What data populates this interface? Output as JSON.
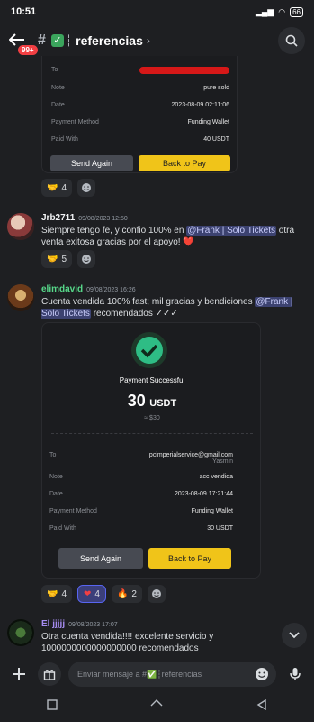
{
  "status_bar": {
    "time": "10:51",
    "battery": "66"
  },
  "header": {
    "unread_badge": "99+",
    "channel_title": "referencias"
  },
  "receipt1": {
    "rows": [
      {
        "key": "To",
        "value": ""
      },
      {
        "key": "Note",
        "value": "pure sold"
      },
      {
        "key": "Date",
        "value": "2023-08-09 02:11:06"
      },
      {
        "key": "Payment Method",
        "value": "Funding Wallet"
      },
      {
        "key": "Paid With",
        "value": "40 USDT"
      }
    ],
    "send_again": "Send Again",
    "back_to_pay": "Back to Pay"
  },
  "reactions1": [
    {
      "emoji": "handshake",
      "count": "4"
    }
  ],
  "msg1": {
    "author": "Jrb2711",
    "timestamp": "09/08/2023 12:50",
    "text_before": "Siempre tengo fe, y confio 100% en ",
    "mention": "@Frank | Solo Tickets",
    "text_after": " otra venta exitosa gracias por el apoyo! ❤️"
  },
  "reactions2": [
    {
      "emoji": "handshake",
      "count": "5"
    }
  ],
  "msg2": {
    "author": "elimdavid",
    "timestamp": "09/08/2023 16:26",
    "text_before": "Cuenta vendida 100% fast; mil gracias y bendiciones ",
    "mention": "@Frank | Solo Tickets",
    "text_after": " recomendados ✓✓✓"
  },
  "receipt2": {
    "status": "Payment Successful",
    "amount": "30",
    "currency": "USDT",
    "usd": "≈ $30",
    "rows": [
      {
        "key": "To",
        "value": "pcimperialservice@gmail.com",
        "sub": "Yasmin"
      },
      {
        "key": "Note",
        "value": "acc vendida"
      },
      {
        "key": "Date",
        "value": "2023-08-09 17:21:44"
      },
      {
        "key": "Payment Method",
        "value": "Funding Wallet"
      },
      {
        "key": "Paid With",
        "value": "30 USDT"
      }
    ],
    "send_again": "Send Again",
    "back_to_pay": "Back to Pay"
  },
  "reactions3": [
    {
      "emoji": "handshake",
      "count": "4"
    },
    {
      "emoji": "heart",
      "count": "4"
    },
    {
      "emoji": "fire",
      "count": "2"
    }
  ],
  "msg3": {
    "author": "El jjjjj",
    "timestamp": "09/08/2023 17:07",
    "text": "Otra cuenta vendida!!!! excelente servicio y 1000000000000000000 recomendados"
  },
  "composer": {
    "placeholder": "Enviar mensaje a #✅┆referencias"
  },
  "colors": {
    "accent": "#5865f2",
    "success": "#3ba55d",
    "yellow": "#f0c419",
    "mention_bg": "#3c4270"
  }
}
